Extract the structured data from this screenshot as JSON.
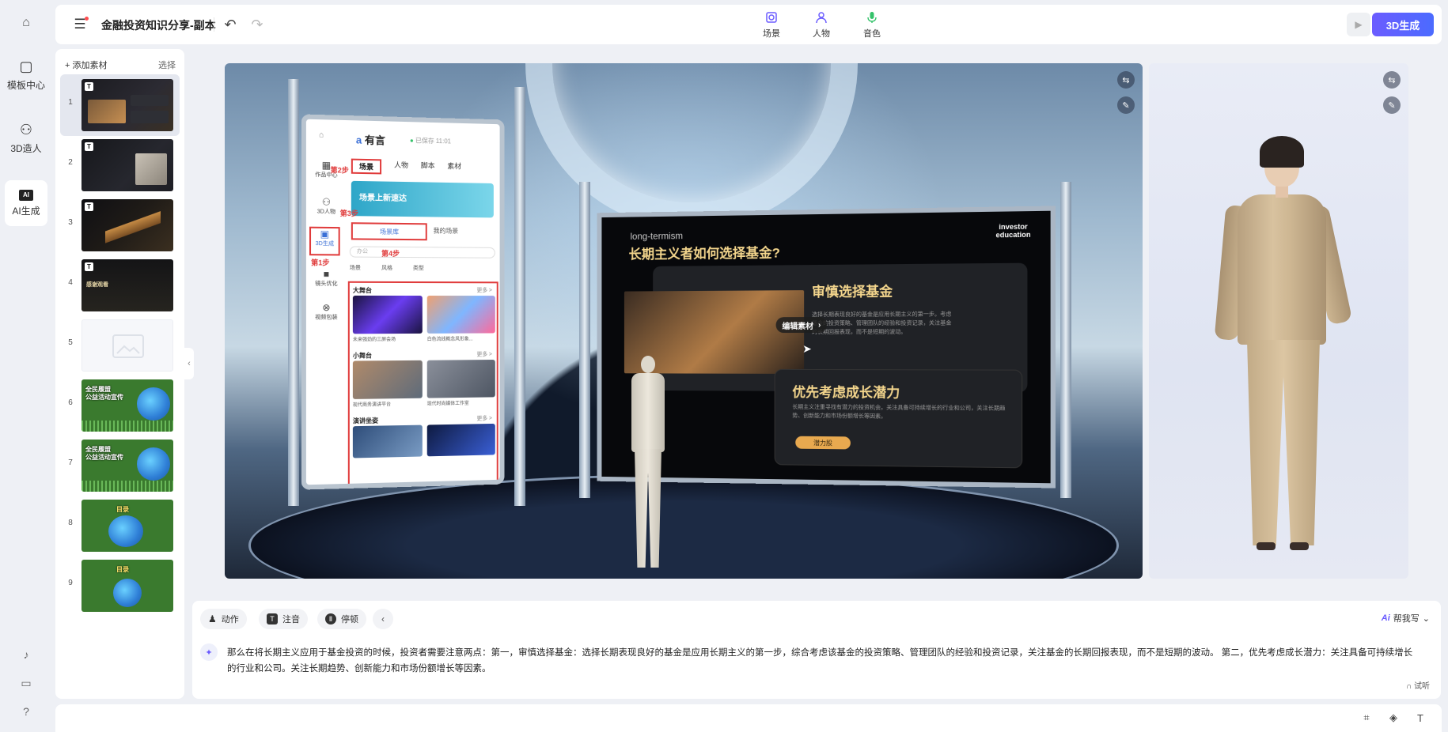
{
  "app": {
    "doc_title": "金融投资知识分享-副本",
    "primary_action": "3D生成"
  },
  "rail": {
    "items": [
      {
        "label": "模板中心",
        "icon": "template-icon"
      },
      {
        "label": "3D造人",
        "icon": "person-icon"
      },
      {
        "label": "AI生成",
        "icon": "ai-icon"
      }
    ]
  },
  "toolbar": {
    "tools": [
      {
        "label": "场景",
        "icon": "scene-icon"
      },
      {
        "label": "人物",
        "icon": "person-icon"
      },
      {
        "label": "音色",
        "icon": "microphone-icon"
      }
    ]
  },
  "slides": {
    "add_label": "添加素材",
    "select_label": "选择",
    "items": [
      {
        "num": "1"
      },
      {
        "num": "2"
      },
      {
        "num": "3"
      },
      {
        "num": "4"
      },
      {
        "num": "5"
      },
      {
        "num": "6"
      },
      {
        "num": "7"
      },
      {
        "num": "8"
      },
      {
        "num": "9"
      }
    ],
    "thumb_texts": {
      "t4": "感谢观看",
      "t6": "全民履盟\n公益活动宣传",
      "t7": "全民履盟\n公益活动宣传",
      "t8": "目录",
      "t9": "目录"
    }
  },
  "stage": {
    "phone": {
      "logo": "有言",
      "saved": "已保存 11:01",
      "tabs": [
        "场景",
        "人物",
        "脚本",
        "素材"
      ],
      "side": [
        "作品中心",
        "3D人物",
        "3D生成",
        "镜头优化",
        "视频包装"
      ],
      "banner": "场景上新速达",
      "lib_tab": "场景库",
      "my_tab": "我的场景",
      "search_placeholder": "办公",
      "filters": [
        "场景",
        "风格",
        "类型"
      ],
      "sections": [
        {
          "title": "大舞台",
          "more": "更多 >",
          "captions": [
            "未来强劲的三屏会场",
            "白色流线概念风形象..."
          ]
        },
        {
          "title": "小舞台",
          "more": "更多 >",
          "captions": [
            "现代商务演讲平台",
            "现代时尚媒体工作室"
          ]
        },
        {
          "title": "演讲坐姿",
          "more": "更多 >"
        }
      ],
      "steps": [
        "第1步",
        "第2步",
        "第3步",
        "第4步"
      ]
    },
    "screen": {
      "subtitle": "long-termism",
      "title": "长期主义者如何选择基金?",
      "brand": "investor\neducation",
      "card1_heading": "审慎选择基金",
      "card1_text": "选择长期表现良好的基金是应用长期主义的第一步。考虑基金的投资策略、管理团队的经验和投资记录，关注基金的长期回报表现，而不是短期的波动。",
      "card2_heading": "优先考虑成长潜力",
      "card2_text": "长期主义注重寻找有潜力的投资机会。关注具备可持续增长的行业和公司，关注长期趋势、创新能力和市场份额增长等因素。",
      "chip": "潜力股",
      "edit_popup": "编辑素材"
    }
  },
  "script": {
    "buttons": [
      "动作",
      "注音",
      "停顿"
    ],
    "ai_help": "帮我写",
    "text": "那么在将长期主义应用于基金投资的时候，投资者需要注意两点：第一，审慎选择基金：选择长期表现良好的基金是应用长期主义的第一步，综合考虑该基金的投资策略、管理团队的经验和投资记录，关注基金的长期回报表现，而不是短期的波动。 第二，优先考虑成长潜力：关注具备可持续增长的行业和公司。关注长期趋势、创新能力和市场份额增长等因素。",
    "try_listen": "试听"
  }
}
